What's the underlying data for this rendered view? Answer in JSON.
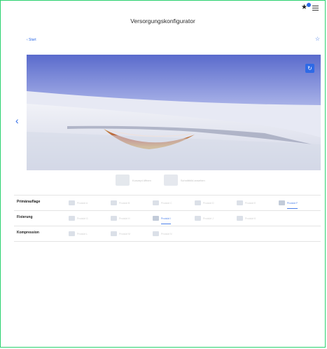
{
  "header": {
    "title": "Versorgungskonfigurator"
  },
  "top_icons": {
    "favorites_icon": "star-with-notification-icon",
    "menu_icon": "menu-icon"
  },
  "nav": {
    "back_label": "‹ Start",
    "favorite_icon": "star-outline-icon",
    "prev_icon": "chevron-left-icon"
  },
  "viewer": {
    "reload_icon": "reload-icon",
    "image": "wound-3d-model"
  },
  "options": [
    {
      "label": "Konzept öffnen"
    },
    {
      "label": "Schnittbild ansehen"
    }
  ],
  "table": {
    "rows": [
      {
        "label": "Primärauflage",
        "cells": [
          {
            "label": "Produkt A"
          },
          {
            "label": "Produkt B"
          },
          {
            "label": "Produkt C"
          },
          {
            "label": "Produkt D"
          },
          {
            "label": "Produkt E"
          },
          {
            "label": "Produkt F"
          }
        ]
      },
      {
        "label": "Fixierung",
        "cells": [
          {
            "label": "Produkt G"
          },
          {
            "label": "Produkt H"
          },
          {
            "label": "Produkt I"
          },
          {
            "label": "Produkt J"
          },
          {
            "label": "Produkt K"
          }
        ]
      },
      {
        "label": "Kompression",
        "cells": [
          {
            "label": "Produkt L"
          },
          {
            "label": "Produkt M"
          },
          {
            "label": "Produkt N"
          }
        ]
      }
    ]
  },
  "colors": {
    "accent": "#2e6ae6",
    "frame": "#2bd16f"
  }
}
